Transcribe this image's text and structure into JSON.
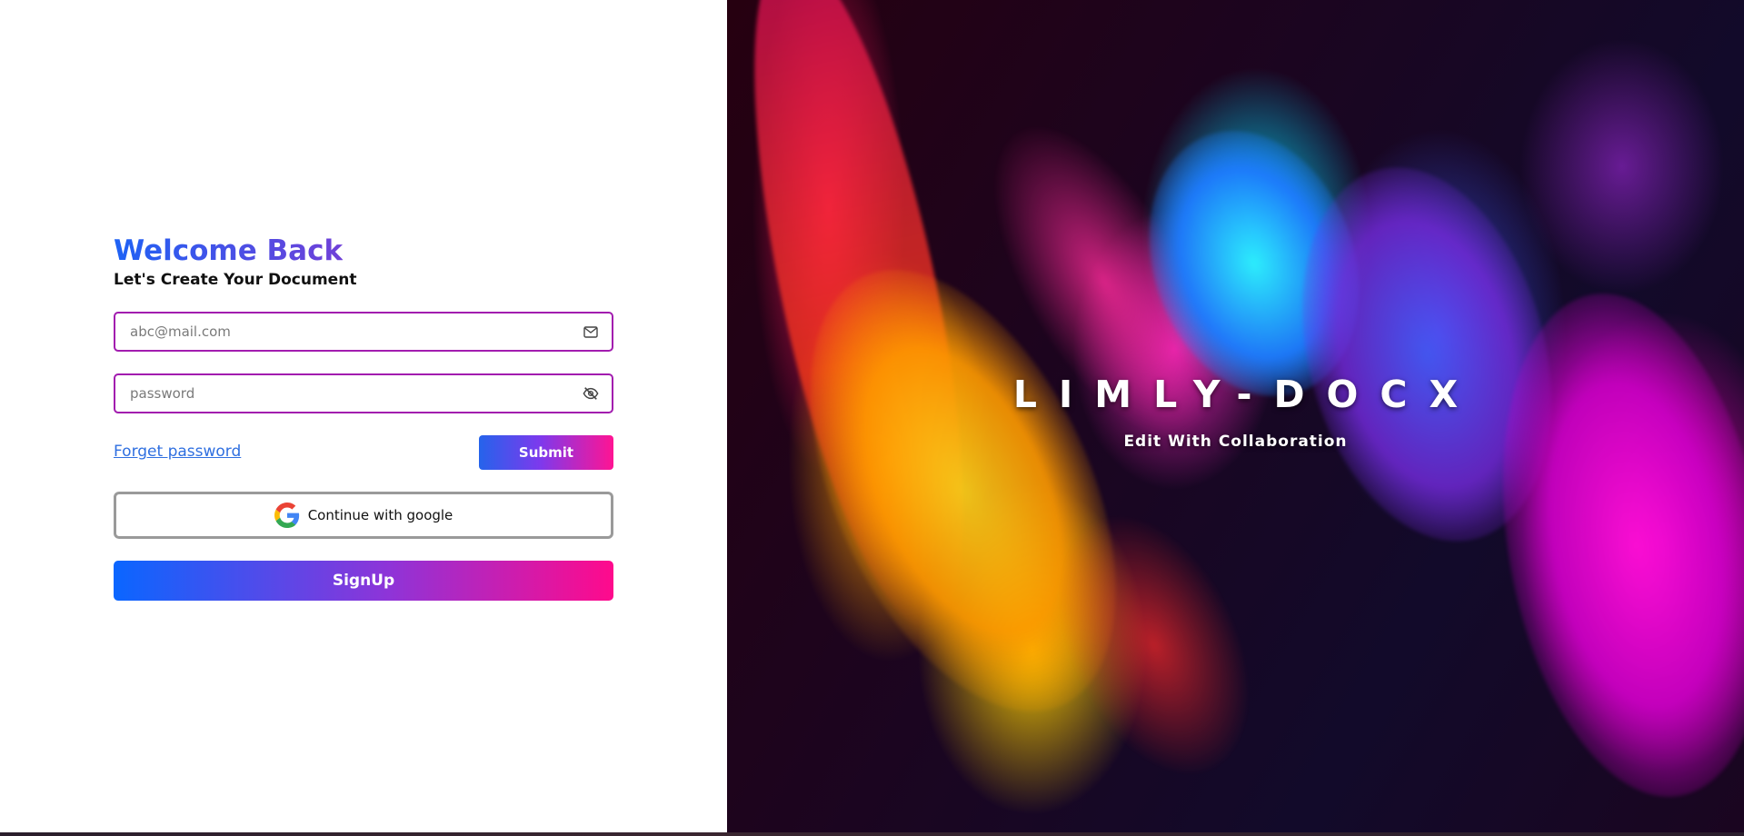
{
  "login": {
    "title": "Welcome Back",
    "subtitle": "Let's Create Your Document",
    "email_placeholder": "abc@mail.com",
    "password_placeholder": "password",
    "forget_password_label": "Forget password",
    "submit_label": "Submit",
    "google_label": "Continue with google",
    "signup_label": "SignUp"
  },
  "brand": {
    "name": "LIMLY-DOCX",
    "tagline": "Edit With Collaboration"
  },
  "icons": {
    "email": "envelope-icon",
    "password": "eye-slash-icon",
    "google": "google-icon"
  },
  "colors": {
    "field_border": "#a21caf",
    "title_gradient_start": "#1e62f5",
    "title_gradient_end": "#7040d8",
    "button_gradient_start": "#0a66ff",
    "button_gradient_end": "#ff0a8c",
    "link": "#2f6fe0"
  }
}
